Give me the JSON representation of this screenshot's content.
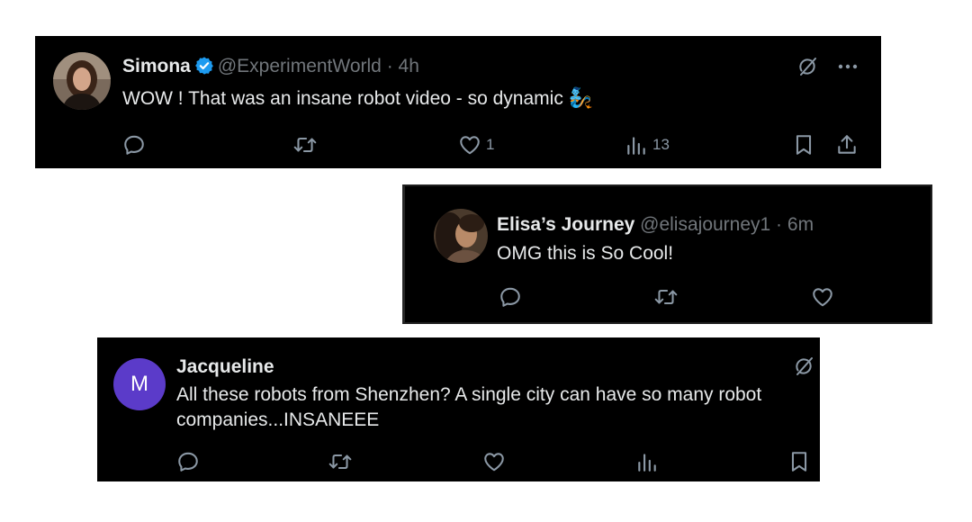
{
  "colors": {
    "card_bg": "#000000",
    "text": "#e7e9ea",
    "muted": "#71767b",
    "icon": "#8b98a5",
    "verified_badge": "#1d9bf0",
    "letter_avatar_bg": "#5b3bc9"
  },
  "posts": [
    {
      "name": "Simona",
      "handle": "@ExperimentWorld",
      "separator": "·",
      "time": "4h",
      "verified": true,
      "text": "WOW ! That was an insane robot video - so dynamic",
      "emoji": "🧞",
      "icons": [
        "grok-icon",
        "more-icon",
        "reply-icon",
        "repost-icon",
        "like-icon",
        "views-icon",
        "bookmark-icon",
        "share-icon"
      ],
      "like_count": "1",
      "view_count": "13"
    },
    {
      "name": "Elisa’s Journey",
      "handle": "@elisajourney1",
      "separator": "·",
      "time": "6m",
      "verified": false,
      "text": "OMG this is So Cool!",
      "icons": [
        "reply-icon",
        "repost-icon",
        "like-icon"
      ]
    },
    {
      "name": "Jacqueline",
      "avatar_letter": "M",
      "text": "All these robots from Shenzhen? A single city can have so many robot companies...INSANEEE",
      "icons": [
        "grok-icon",
        "reply-icon",
        "repost-icon",
        "like-icon",
        "views-icon",
        "bookmark-icon"
      ]
    }
  ]
}
